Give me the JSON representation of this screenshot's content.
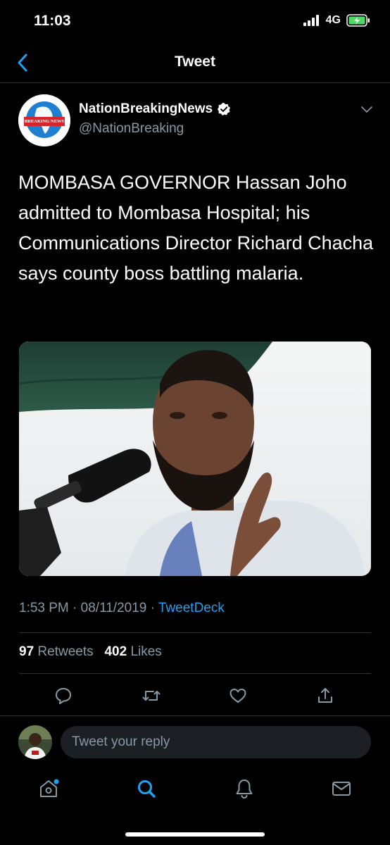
{
  "status_bar": {
    "time": "11:03",
    "network": "4G"
  },
  "nav": {
    "title": "Tweet"
  },
  "tweet": {
    "author_name": "NationBreakingNews",
    "handle": "@NationBreaking",
    "avatar_text": "BREAKING NEWS",
    "text": "MOMBASA GOVERNOR Hassan Joho admitted to Mombasa Hospital; his Communications Director Richard Chacha says county boss battling malaria.",
    "time": "1:53 PM",
    "date": "08/11/2019",
    "source": "TweetDeck",
    "retweets_count": "97",
    "retweets_label": "Retweets",
    "likes_count": "402",
    "likes_label": "Likes"
  },
  "reply": {
    "placeholder": "Tweet your reply"
  },
  "icons": {
    "back": "chevron-left-icon",
    "verified": "verified-badge-icon",
    "more": "chevron-down-icon",
    "reply": "comment-icon",
    "retweet": "retweet-icon",
    "like": "heart-icon",
    "share": "share-icon",
    "home": "home-icon",
    "search": "search-icon",
    "notifications": "bell-icon",
    "messages": "mail-icon"
  },
  "colors": {
    "accent": "#1da1f2",
    "background": "#000000",
    "muted": "#8899a6",
    "battery": "#4cd964"
  }
}
